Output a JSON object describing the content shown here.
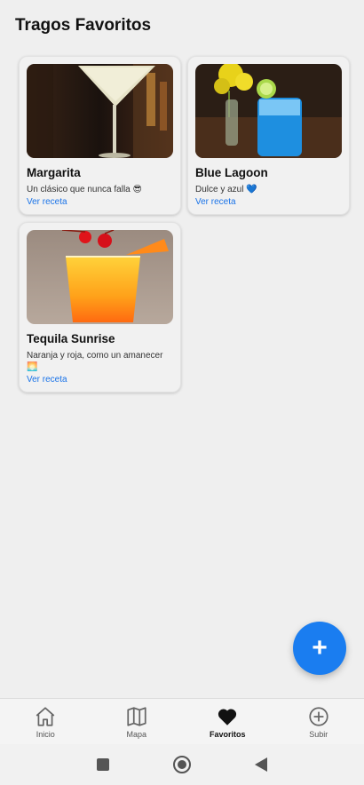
{
  "header": {
    "title": "Tragos Favoritos"
  },
  "cards": [
    {
      "name": "Margarita",
      "description": "Un clásico que nunca falla 😎",
      "link": "Ver receta"
    },
    {
      "name": "Blue Lagoon",
      "description": "Dulce y azul 💙",
      "link": "Ver receta"
    },
    {
      "name": "Tequila Sunrise",
      "description": "Naranja y roja, como un amanecer 🌅",
      "link": "Ver receta"
    }
  ],
  "fab": {
    "label": "+"
  },
  "nav": {
    "items": [
      {
        "label": "Inicio",
        "icon": "home-icon"
      },
      {
        "label": "Mapa",
        "icon": "map-icon"
      },
      {
        "label": "Favoritos",
        "icon": "heart-icon"
      },
      {
        "label": "Subir",
        "icon": "add-circle-icon"
      }
    ],
    "active": "Favoritos"
  },
  "system_nav": {
    "icons": [
      "recents-icon",
      "home-icon",
      "back-icon"
    ]
  },
  "colors": {
    "accent": "#1a7df0",
    "link": "#1a73e8"
  }
}
